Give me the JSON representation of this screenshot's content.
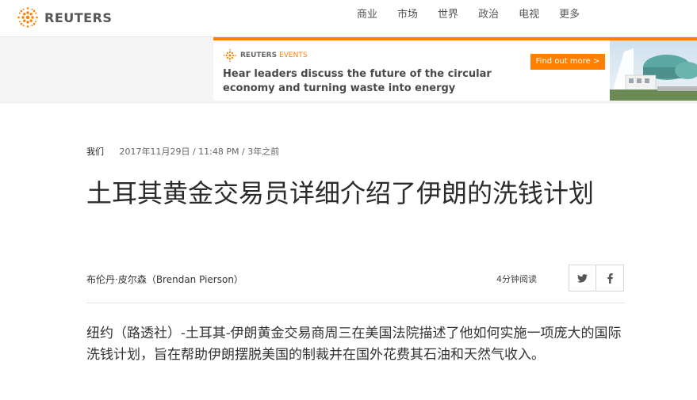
{
  "header": {
    "brand": "REUTERS",
    "nav": [
      "商业",
      "市场",
      "世界",
      "政治",
      "电视",
      "更多"
    ]
  },
  "ad": {
    "brand": "REUTERS",
    "brand_sub": "EVENTS",
    "headline": "Hear leaders discuss the future of the circular economy and turning waste into energy",
    "cta": "Find out more  >",
    "accent_color": "#ff8000"
  },
  "article": {
    "section": "我们",
    "date": "2017年11月29日 / 11:48 PM / 3年之前",
    "headline": "土耳其黄金交易员详细介绍了伊朗的洗钱计划",
    "byline": "布伦丹·皮尔森（Brendan Pierson）",
    "read_time": "4分钟阅读",
    "share_icons": [
      "twitter-icon",
      "facebook-icon"
    ],
    "body": "纽约（路透社）-土耳其-伊朗黄金交易商周三在美国法院描述了他如何实施一项庞大的国际洗钱计划，旨在帮助伊朗摆脱美国的制裁并在国外花费其石油和天然气收入。"
  }
}
